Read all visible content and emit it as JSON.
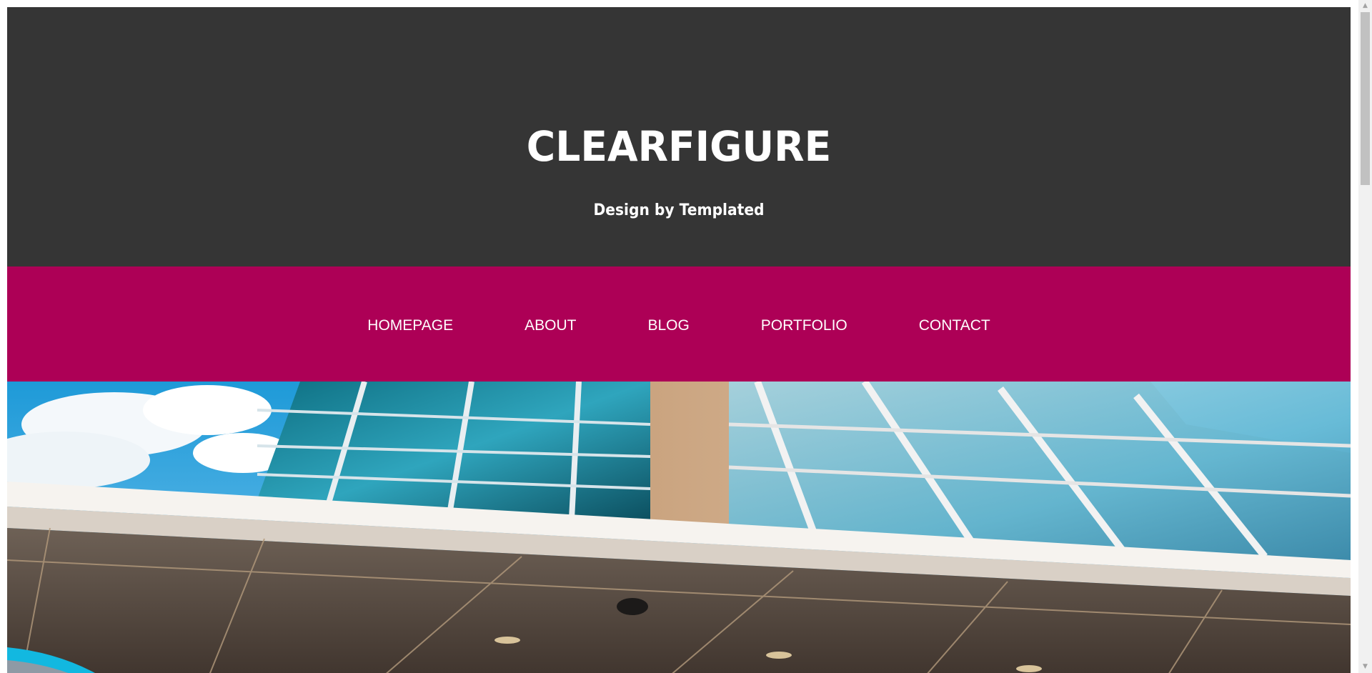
{
  "header": {
    "title": "CLEARFIGURE",
    "tagline": "Design by Templated"
  },
  "menu": {
    "items": [
      {
        "label": "HOMEPAGE"
      },
      {
        "label": "ABOUT"
      },
      {
        "label": "BLOG"
      },
      {
        "label": "PORTFOLIO"
      },
      {
        "label": "CONTACT"
      }
    ]
  },
  "colors": {
    "header_bg": "#353535",
    "menu_bg": "#ad0056",
    "text": "#ffffff"
  },
  "icons": {
    "scroll_up": "arrow-up-icon",
    "scroll_down": "arrow-down-icon"
  }
}
